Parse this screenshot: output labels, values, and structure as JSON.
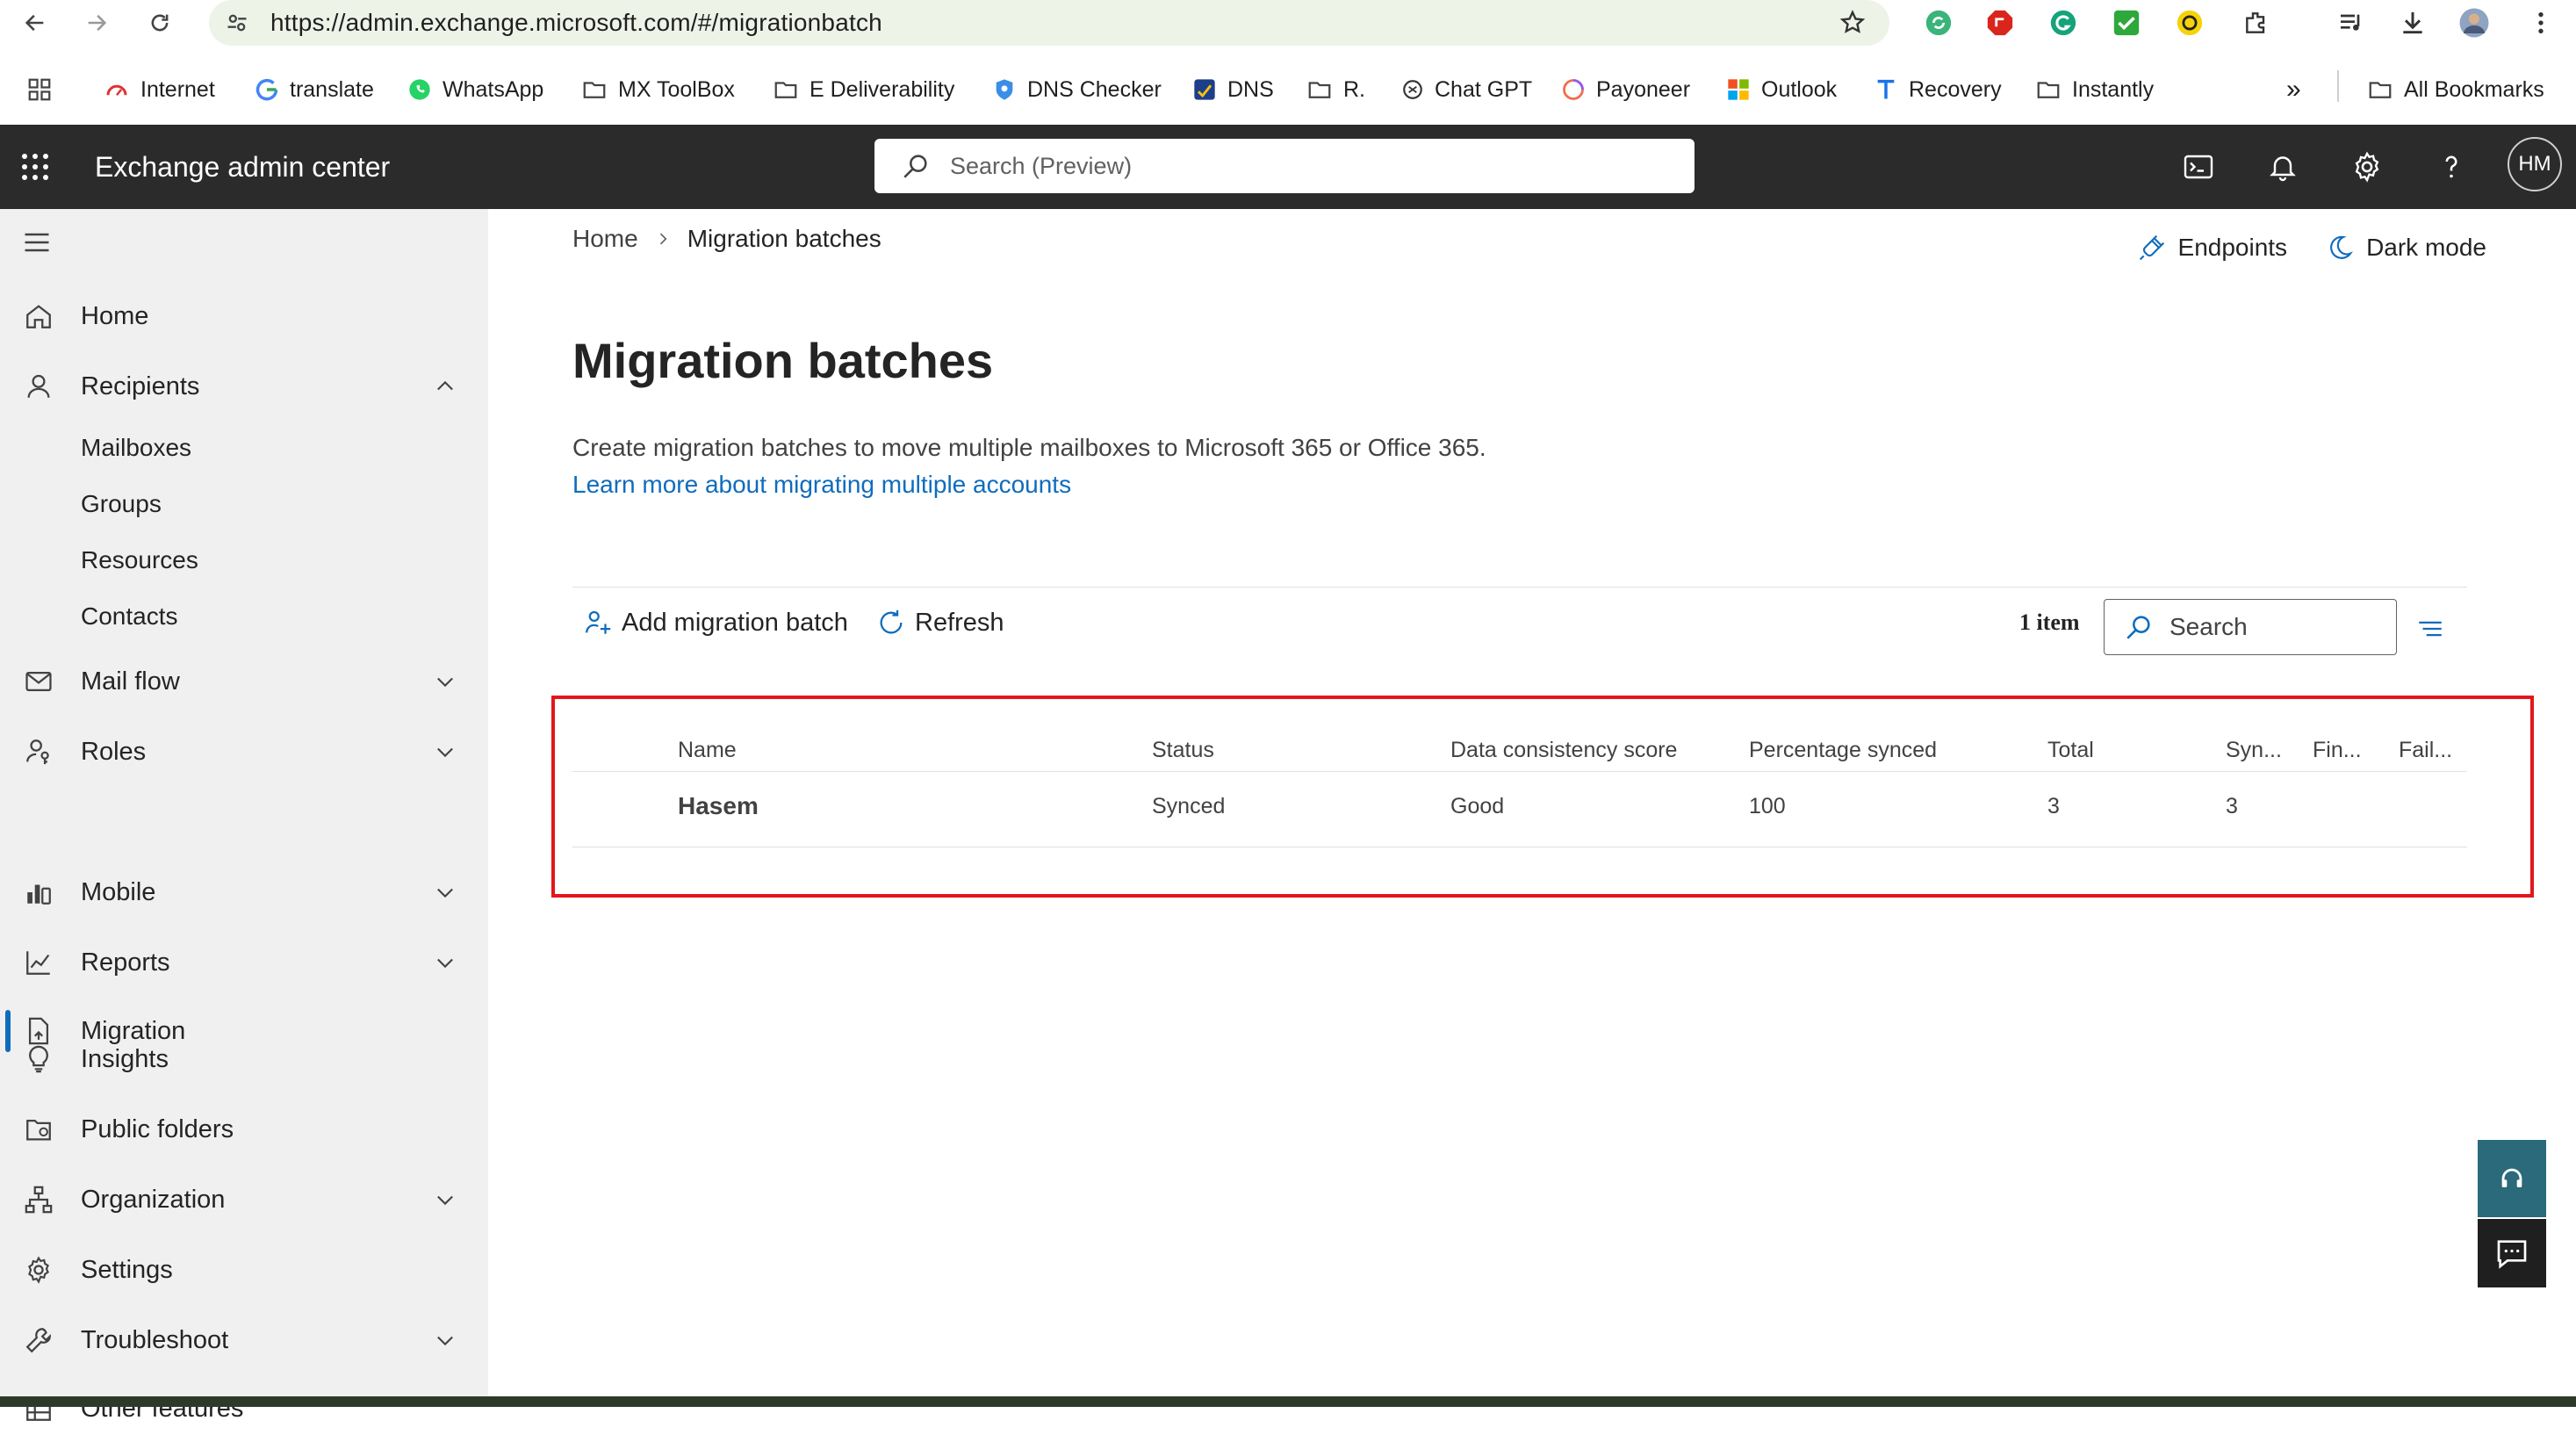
{
  "browser": {
    "url": "https://admin.exchange.microsoft.com/#/migrationbatch",
    "bookmarks": [
      {
        "label": "Internet"
      },
      {
        "label": "translate"
      },
      {
        "label": "WhatsApp"
      },
      {
        "label": "MX ToolBox"
      },
      {
        "label": "E Deliverability"
      },
      {
        "label": "DNS Checker"
      },
      {
        "label": "DNS"
      },
      {
        "label": "R."
      },
      {
        "label": "Chat GPT"
      },
      {
        "label": "Payoneer"
      },
      {
        "label": "Outlook"
      },
      {
        "label": "Recovery"
      },
      {
        "label": "Instantly"
      }
    ],
    "more_bookmarks": "»",
    "all_bookmarks": "All Bookmarks"
  },
  "header": {
    "app_title": "Exchange admin center",
    "search_placeholder": "Search (Preview)",
    "avatar_initials": "HM"
  },
  "sidebar": {
    "items": {
      "home": "Home",
      "recipients": "Recipients",
      "mail_flow": "Mail flow",
      "roles": "Roles",
      "migration": "Migration",
      "mobile": "Mobile",
      "reports": "Reports",
      "insights": "Insights",
      "public_folders": "Public folders",
      "organization": "Organization",
      "settings": "Settings",
      "troubleshoot": "Troubleshoot",
      "other_features": "Other features"
    },
    "recipients_sub": [
      "Mailboxes",
      "Groups",
      "Resources",
      "Contacts"
    ]
  },
  "main": {
    "breadcrumb": {
      "home": "Home",
      "current": "Migration batches"
    },
    "top_actions": {
      "endpoints": "Endpoints",
      "dark_mode": "Dark mode"
    },
    "title": "Migration batches",
    "description": "Create migration batches to move multiple mailboxes to Microsoft 365 or Office 365.",
    "learn_more": "Learn more about migrating multiple accounts",
    "toolbar": {
      "add": "Add migration batch",
      "refresh": "Refresh",
      "item_count": "1 item",
      "search_placeholder": "Search"
    },
    "table": {
      "columns": [
        "Name",
        "Status",
        "Data consistency score",
        "Percentage synced",
        "Total",
        "Syn...",
        "Fin...",
        "Fail..."
      ],
      "rows": [
        {
          "name": "Hasem",
          "status": "Synced",
          "consistency": "Good",
          "percentage": "100",
          "total": "3",
          "synced": "3",
          "finalized": "",
          "failed": ""
        }
      ]
    }
  },
  "colors": {
    "accent": "#0f6cbd",
    "header_bg": "#2b2b2b",
    "sidebar_bg": "#f0f0f0",
    "highlight_border": "#e3161b"
  }
}
